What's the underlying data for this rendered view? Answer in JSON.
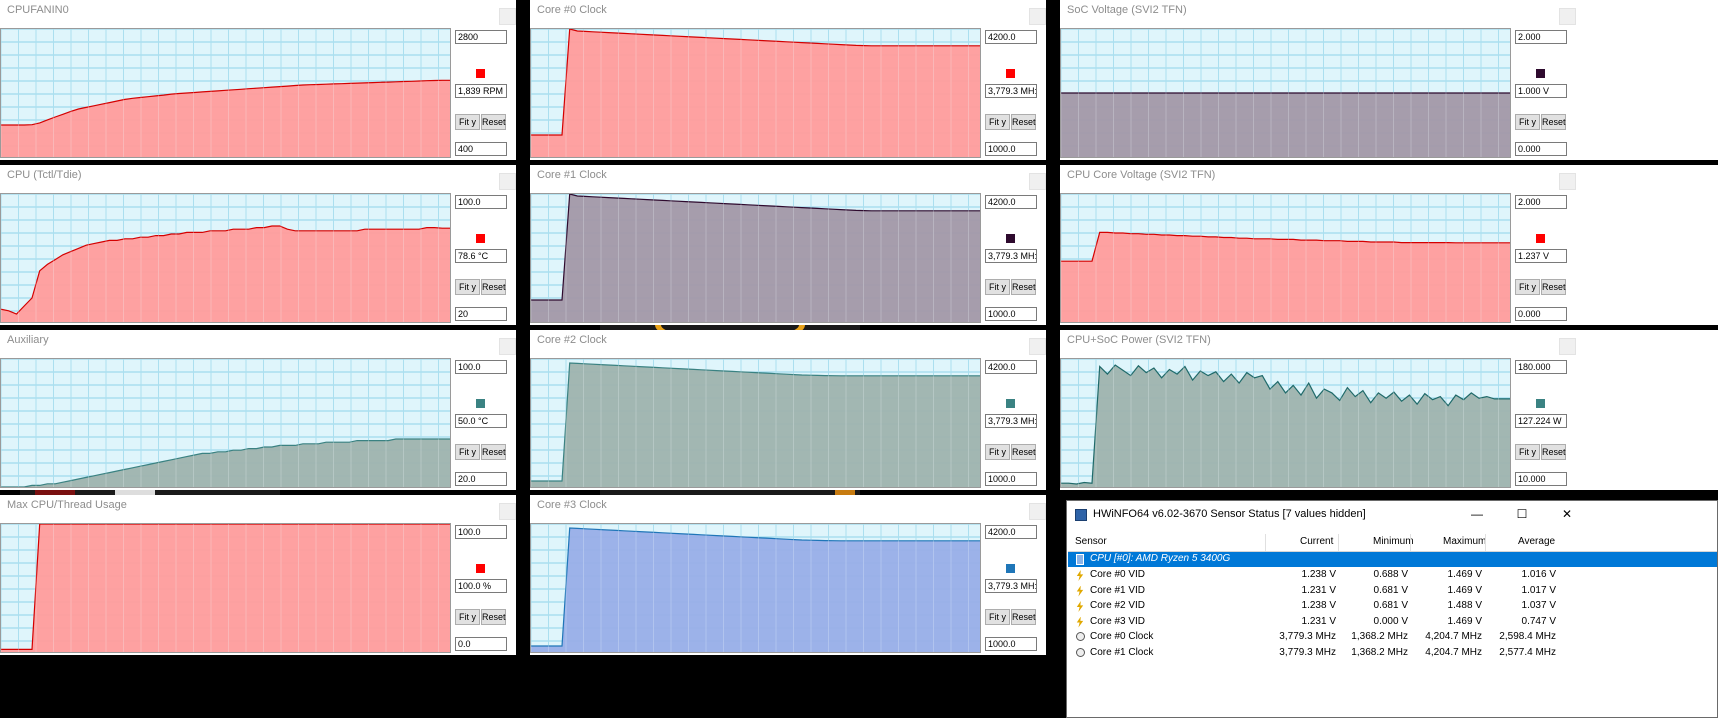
{
  "colors": {
    "red": "#ff0000",
    "pinkFill": "#ff9c9c",
    "darkRed": "#d40000",
    "purple": "#2e0a2e",
    "mauveFill": "#a298a8",
    "teal": "#3a8282",
    "tealFill": "#9eb3ae",
    "blue": "#1f76b8",
    "blueFill": "#98aee8",
    "plotBg": "#dff5fb",
    "grid": "#8fd4ea"
  },
  "graphs": [
    {
      "id": "g0",
      "title": "CPUFANIN0",
      "max": "2800",
      "current": "1,839 RPM",
      "min": "400",
      "swatch": "#ff0000",
      "scale_max": 2800,
      "scale_min": 400,
      "line": "#d40000",
      "fill": "#ff9c9c",
      "series": [
        1000,
        1000,
        1000,
        1000,
        1005,
        1040,
        1095,
        1150,
        1200,
        1255,
        1300,
        1330,
        1360,
        1390,
        1420,
        1450,
        1480,
        1500,
        1515,
        1530,
        1545,
        1560,
        1580,
        1590,
        1600,
        1610,
        1620,
        1630,
        1640,
        1650,
        1660,
        1670,
        1680,
        1690,
        1700,
        1710,
        1720,
        1730,
        1740,
        1750,
        1755,
        1760,
        1765,
        1770,
        1775,
        1780,
        1785,
        1790,
        1795,
        1800,
        1805,
        1810,
        1815,
        1820,
        1825,
        1830,
        1835,
        1839,
        1839
      ]
    },
    {
      "id": "g1",
      "title": "Core #0 Clock",
      "max": "4200.0",
      "current": "3,779.3 MH:",
      "min": "1000.0",
      "swatch": "#ff0000",
      "scale_max": 4200,
      "scale_min": 1000,
      "line": "#d40000",
      "fill": "#ff9c9c",
      "series": [
        1550,
        1550,
        1550,
        1550,
        1550,
        4200,
        4150,
        4140,
        4130,
        4120,
        4110,
        4100,
        4090,
        4080,
        4070,
        4060,
        4050,
        4040,
        4030,
        4020,
        4010,
        4000,
        3990,
        3980,
        3970,
        3960,
        3950,
        3940,
        3930,
        3920,
        3910,
        3900,
        3890,
        3880,
        3870,
        3860,
        3850,
        3840,
        3830,
        3820,
        3810,
        3800,
        3790,
        3785,
        3780,
        3779,
        3779,
        3779,
        3779,
        3779,
        3779,
        3779,
        3779,
        3779,
        3779,
        3779,
        3779,
        3779,
        3779
      ]
    },
    {
      "id": "g2",
      "title": "SoC Voltage (SVI2 TFN)",
      "max": "2.000",
      "current": "1.000 V",
      "min": "0.000",
      "swatch": "#2e0a2e",
      "scale_max": 2,
      "scale_min": 0,
      "line": "#2e0a2e",
      "fill": "#a298a8",
      "series": [
        1,
        1,
        1,
        1,
        1,
        1,
        1,
        1,
        1,
        1,
        1,
        1,
        1,
        1,
        1,
        1,
        1,
        1,
        1,
        1,
        1,
        1,
        1,
        1,
        1,
        1,
        1,
        1,
        1,
        1,
        1,
        1,
        1,
        1,
        1,
        1,
        1,
        1,
        1,
        1,
        1,
        1,
        1,
        1,
        1,
        1,
        1,
        1,
        1,
        1,
        1,
        1,
        1,
        1,
        1,
        1,
        1,
        1,
        1
      ]
    },
    {
      "id": "g3",
      "title": "CPU (Tctl/Tdie)",
      "max": "100.0",
      "current": "78.6 °C",
      "min": "20",
      "swatch": "#ff0000",
      "scale_max": 100,
      "scale_min": 20,
      "line": "#d40000",
      "fill": "#ff9c9c",
      "series": [
        28,
        27,
        25,
        30,
        35,
        52,
        56,
        59,
        62,
        64,
        66,
        68,
        69,
        70,
        71,
        71,
        72,
        72,
        73,
        73,
        74,
        74,
        75,
        75,
        76,
        76,
        76,
        77,
        77,
        77,
        78,
        78,
        78,
        79,
        79,
        80,
        80,
        78,
        77,
        77,
        77,
        77,
        77,
        77,
        77,
        77,
        77,
        78,
        78,
        78,
        78,
        78,
        78,
        78,
        78,
        79,
        79,
        78.6,
        78.6
      ]
    },
    {
      "id": "g4",
      "title": "Core #1 Clock",
      "max": "4200.0",
      "current": "3,779.3 MH:",
      "min": "1000.0",
      "swatch": "#2e0a2e",
      "scale_max": 4200,
      "scale_min": 1000,
      "line": "#2e0a2e",
      "fill": "#a298a8",
      "series": [
        1550,
        1550,
        1550,
        1550,
        1550,
        4200,
        4150,
        4140,
        4130,
        4120,
        4110,
        4100,
        4090,
        4080,
        4070,
        4060,
        4050,
        4040,
        4030,
        4020,
        4010,
        4000,
        3990,
        3980,
        3970,
        3960,
        3950,
        3940,
        3930,
        3920,
        3910,
        3900,
        3890,
        3880,
        3870,
        3860,
        3850,
        3840,
        3830,
        3820,
        3810,
        3800,
        3790,
        3785,
        3780,
        3779,
        3779,
        3779,
        3779,
        3779,
        3779,
        3779,
        3779,
        3779,
        3779,
        3779,
        3779,
        3779,
        3779
      ]
    },
    {
      "id": "g5",
      "title": "CPU Core Voltage (SVI2 TFN)",
      "max": "2.000",
      "current": "1.237 V",
      "min": "0.000",
      "swatch": "#ff0000",
      "scale_max": 2,
      "scale_min": 0,
      "line": "#d40000",
      "fill": "#ff9c9c",
      "series": [
        0.95,
        0.95,
        0.95,
        0.95,
        0.95,
        1.4,
        1.4,
        1.39,
        1.39,
        1.38,
        1.38,
        1.37,
        1.37,
        1.36,
        1.36,
        1.35,
        1.35,
        1.34,
        1.34,
        1.33,
        1.33,
        1.32,
        1.32,
        1.31,
        1.31,
        1.3,
        1.3,
        1.3,
        1.29,
        1.29,
        1.29,
        1.28,
        1.28,
        1.28,
        1.27,
        1.27,
        1.27,
        1.26,
        1.26,
        1.26,
        1.25,
        1.25,
        1.25,
        1.25,
        1.24,
        1.24,
        1.24,
        1.24,
        1.24,
        1.24,
        1.24,
        1.237,
        1.237,
        1.237,
        1.237,
        1.237,
        1.237,
        1.237,
        1.237
      ]
    },
    {
      "id": "g6",
      "title": "Auxiliary",
      "max": "100.0",
      "current": "50.0 °C",
      "min": "20.0",
      "swatch": "#3a8282",
      "scale_max": 100,
      "scale_min": 20,
      "line": "#3a8282",
      "fill": "#9eb3ae",
      "series": [
        20,
        20,
        20,
        20,
        21,
        21,
        22,
        22,
        23,
        24,
        25,
        26,
        27,
        28,
        29,
        30,
        31,
        32,
        33,
        34,
        35,
        36,
        37,
        38,
        39,
        40,
        41,
        41,
        42,
        42,
        43,
        43,
        44,
        44,
        45,
        45,
        46,
        46,
        46,
        47,
        47,
        47,
        48,
        48,
        48,
        48,
        49,
        49,
        49,
        49,
        49,
        50,
        50,
        50,
        50,
        50,
        50,
        50,
        50
      ]
    },
    {
      "id": "g7",
      "title": "Core #2 Clock",
      "max": "4200.0",
      "current": "3,779.3 MH:",
      "min": "1000.0",
      "swatch": "#3a8282",
      "scale_max": 4200,
      "scale_min": 1000,
      "line": "#3a8282",
      "fill": "#9eb3ae",
      "series": [
        1150,
        1150,
        1150,
        1150,
        1150,
        4100,
        4090,
        4080,
        4070,
        4060,
        4050,
        4040,
        4030,
        4020,
        4010,
        4000,
        3990,
        3980,
        3970,
        3960,
        3950,
        3940,
        3930,
        3920,
        3910,
        3900,
        3890,
        3880,
        3870,
        3860,
        3850,
        3840,
        3830,
        3820,
        3810,
        3800,
        3795,
        3790,
        3785,
        3782,
        3780,
        3779,
        3779,
        3779,
        3779,
        3779,
        3779,
        3779,
        3779,
        3779,
        3779,
        3779,
        3779,
        3779,
        3779,
        3779,
        3779,
        3779,
        3779
      ]
    },
    {
      "id": "g8",
      "title": "CPU+SoC Power (SVI2 TFN)",
      "max": "180.000",
      "current": "127.224 W",
      "min": "10.000",
      "swatch": "#3a8282",
      "scale_max": 180,
      "scale_min": 10,
      "line": "#1f6a6a",
      "fill": "#9eb3ae",
      "series": [
        15,
        15,
        14,
        16,
        15,
        170,
        160,
        172,
        165,
        158,
        171,
        162,
        168,
        155,
        166,
        160,
        170,
        152,
        164,
        158,
        163,
        150,
        160,
        148,
        162,
        155,
        158,
        140,
        150,
        135,
        145,
        132,
        148,
        128,
        140,
        135,
        125,
        142,
        130,
        138,
        122,
        135,
        128,
        136,
        124,
        132,
        120,
        134,
        126,
        130,
        118,
        132,
        126,
        135,
        128,
        130,
        127,
        127,
        127
      ]
    },
    {
      "id": "g9",
      "title": "Max CPU/Thread Usage",
      "max": "100.0",
      "current": "100.0 %",
      "min": "0.0",
      "swatch": "#ff0000",
      "scale_max": 100,
      "scale_min": 0,
      "line": "#d40000",
      "fill": "#ff9c9c",
      "series": [
        2,
        2,
        2,
        2,
        2,
        100,
        100,
        100,
        100,
        100,
        100,
        100,
        100,
        100,
        100,
        100,
        100,
        100,
        100,
        100,
        100,
        100,
        100,
        100,
        100,
        100,
        100,
        100,
        100,
        100,
        100,
        100,
        100,
        100,
        100,
        100,
        100,
        100,
        100,
        100,
        100,
        100,
        100,
        100,
        100,
        100,
        100,
        100,
        100,
        100,
        100,
        100,
        100,
        100,
        100,
        100,
        100,
        100,
        100
      ]
    },
    {
      "id": "g10",
      "title": "Core #3 Clock",
      "max": "4200.0",
      "current": "3,779.3 MH:",
      "min": "1000.0",
      "swatch": "#1f76b8",
      "scale_max": 4200,
      "scale_min": 1000,
      "line": "#1f76b8",
      "fill": "#98aee8",
      "series": [
        1150,
        1150,
        1150,
        1150,
        1150,
        4100,
        4090,
        4080,
        4070,
        4060,
        4050,
        4040,
        4030,
        4020,
        4010,
        4000,
        3990,
        3980,
        3970,
        3960,
        3950,
        3940,
        3930,
        3920,
        3910,
        3900,
        3890,
        3880,
        3870,
        3860,
        3850,
        3840,
        3830,
        3820,
        3810,
        3800,
        3795,
        3790,
        3785,
        3782,
        3780,
        3779,
        3779,
        3779,
        3779,
        3779,
        3779,
        3779,
        3779,
        3779,
        3779,
        3779,
        3779,
        3779,
        3779,
        3779,
        3779,
        3779,
        3779
      ]
    }
  ],
  "buttons": {
    "fit": "Fit y",
    "reset": "Reset"
  },
  "sensorWindow": {
    "title": "HWiNFO64 v6.02-3670 Sensor Status [7 values hidden]",
    "controls": {
      "minimize": "—",
      "maximize": "☐",
      "close": "✕"
    },
    "columns": [
      "Sensor",
      "Current",
      "Minimum",
      "Maximum",
      "Average"
    ],
    "group": "CPU [#0]: AMD Ryzen 5 3400G",
    "rows": [
      {
        "name": "Core #0 VID",
        "current": "1.238 V",
        "min": "0.688 V",
        "max": "1.469 V",
        "avg": "1.016 V",
        "icon": "lightning-icon"
      },
      {
        "name": "Core #1 VID",
        "current": "1.231 V",
        "min": "0.681 V",
        "max": "1.469 V",
        "avg": "1.017 V",
        "icon": "lightning-icon"
      },
      {
        "name": "Core #2 VID",
        "current": "1.238 V",
        "min": "0.681 V",
        "max": "1.488 V",
        "avg": "1.037 V",
        "icon": "lightning-icon"
      },
      {
        "name": "Core #3 VID",
        "current": "1.231 V",
        "min": "0.000 V",
        "max": "1.469 V",
        "avg": "0.747 V",
        "icon": "lightning-icon"
      },
      {
        "name": "Core #0 Clock",
        "current": "3,779.3 MHz",
        "min": "1,368.2 MHz",
        "max": "4,204.7 MHz",
        "avg": "2,598.4 MHz",
        "icon": "clock-icon"
      },
      {
        "name": "Core #1 Clock",
        "current": "3,779.3 MHz",
        "min": "1,368.2 MHz",
        "max": "4,204.7 MHz",
        "avg": "2,577.4 MHz",
        "icon": "clock-icon"
      }
    ]
  }
}
